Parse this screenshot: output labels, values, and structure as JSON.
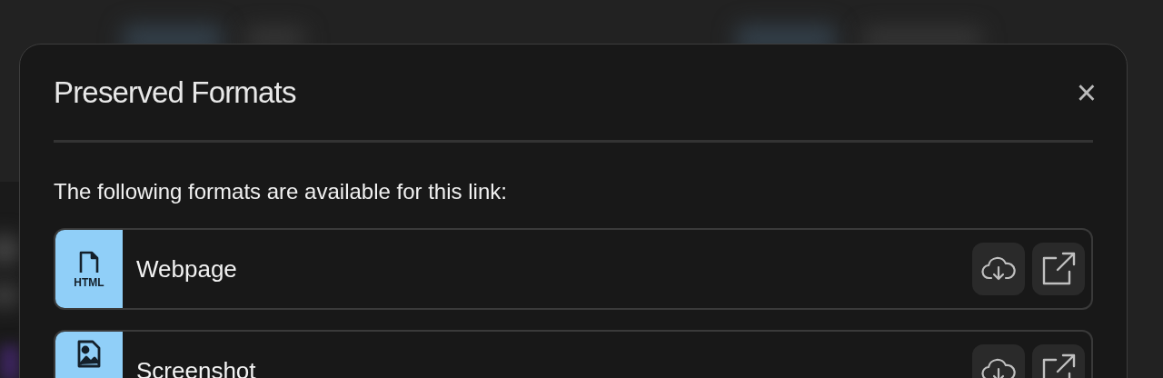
{
  "dialog": {
    "title": "Preserved Formats",
    "close": "×"
  },
  "intro": "The following formats are available for this link:",
  "formats": [
    {
      "kind": "html",
      "icon_label": "HTML",
      "name": "Webpage"
    },
    {
      "kind": "image",
      "name": "Screenshot"
    }
  ]
}
